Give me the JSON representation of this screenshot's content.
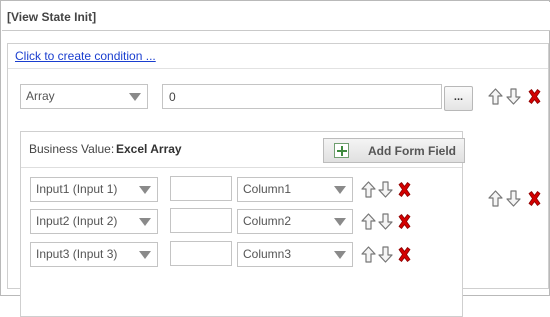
{
  "window": {
    "title": "[View State Init]"
  },
  "condition": {
    "link_label": "Click to create condition ..."
  },
  "main_row": {
    "type_select": "Array",
    "value": "0",
    "browse_label": "..."
  },
  "business_value": {
    "label": "Business Value:",
    "value": "Excel Array",
    "add_button_label": "Add Form Field"
  },
  "fields": [
    {
      "input": "Input1 (Input 1)",
      "text": "",
      "column": "Column1"
    },
    {
      "input": "Input2 (Input 2)",
      "text": "",
      "column": "Column2"
    },
    {
      "input": "Input3 (Input 3)",
      "text": "",
      "column": "Column3"
    }
  ],
  "colors": {
    "link": "#1a3ecf",
    "delete": "#d40000",
    "arrow_fill": "#f5f5f5",
    "arrow_stroke": "#777777"
  },
  "icons": {
    "move_up": "arrow-up-icon",
    "move_down": "arrow-down-icon",
    "delete": "delete-x-icon",
    "add": "plus-box-icon"
  }
}
